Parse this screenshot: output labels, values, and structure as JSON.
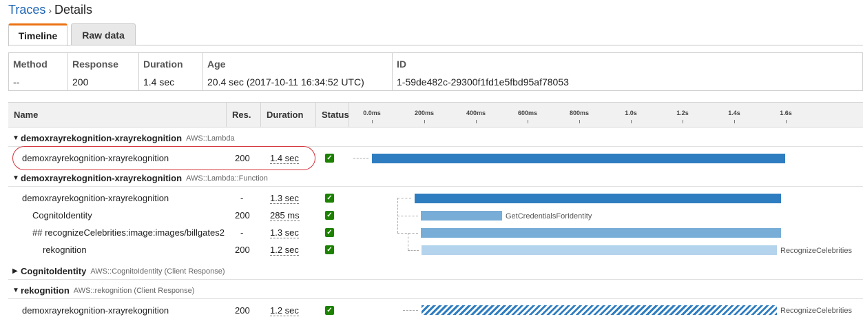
{
  "breadcrumb": {
    "parent": "Traces",
    "separator": "›",
    "current": "Details"
  },
  "tabs": [
    {
      "label": "Timeline",
      "active": true
    },
    {
      "label": "Raw data",
      "active": false
    }
  ],
  "summary": {
    "method": {
      "label": "Method",
      "value": "--"
    },
    "response": {
      "label": "Response",
      "value": "200"
    },
    "duration": {
      "label": "Duration",
      "value": "1.4 sec"
    },
    "age": {
      "label": "Age",
      "value": "20.4 sec (2017-10-11 16:34:52 UTC)"
    },
    "id": {
      "label": "ID",
      "value": "1-59de482c-29300f1fd1e5fbd95af78053"
    }
  },
  "table": {
    "headers": {
      "name": "Name",
      "res": "Res.",
      "duration": "Duration",
      "status": "Status"
    },
    "ticks": [
      "0.0ms",
      "200ms",
      "400ms",
      "600ms",
      "800ms",
      "1.0s",
      "1.2s",
      "1.4s",
      "1.6s"
    ]
  },
  "groups": [
    {
      "name": "demoxrayrekognition-xrayrekognition",
      "type": "AWS::Lambda",
      "expanded": true
    },
    {
      "name": "demoxrayrekognition-xrayrekognition",
      "type": "AWS::Lambda::Function",
      "expanded": true
    },
    {
      "name": "CognitoIdentity",
      "type": "AWS::CognitoIdentity (Client Response)",
      "expanded": false
    },
    {
      "name": "rekognition",
      "type": "AWS::rekognition (Client Response)",
      "expanded": true
    }
  ],
  "rows": [
    {
      "name": "demoxrayrekognition-xrayrekognition",
      "res": "200",
      "duration": "1.4 sec",
      "status": "ok",
      "bar_label": ""
    },
    {
      "name": "demoxrayrekognition-xrayrekognition",
      "res": "-",
      "duration": "1.3 sec",
      "status": "ok",
      "bar_label": ""
    },
    {
      "name": "CognitoIdentity",
      "res": "200",
      "duration": "285 ms",
      "status": "ok",
      "bar_label": "GetCredentialsForIdentity"
    },
    {
      "name": "## recognizeCelebrities:image:images/billgates2",
      "res": "-",
      "duration": "1.3 sec",
      "status": "ok",
      "bar_label": ""
    },
    {
      "name": "rekognition",
      "res": "200",
      "duration": "1.2 sec",
      "status": "ok",
      "bar_label": "RecognizeCelebrities"
    },
    {
      "name": "demoxrayrekognition-xrayrekognition",
      "res": "200",
      "duration": "1.2 sec",
      "status": "ok",
      "bar_label": "RecognizeCelebrities"
    }
  ],
  "colors": {
    "link": "#1a62b4",
    "accent_tab": "#ec7211",
    "bar": "#2f7dc1",
    "status_ok": "#1d8102",
    "highlight": "#d4343b"
  }
}
